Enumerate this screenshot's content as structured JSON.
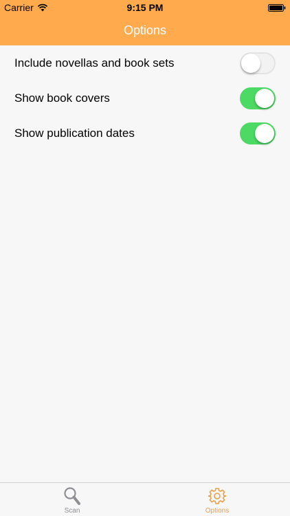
{
  "status": {
    "carrier": "Carrier",
    "time": "9:15 PM"
  },
  "header": {
    "title": "Options"
  },
  "options": [
    {
      "label": "Include novellas and book sets",
      "enabled": false
    },
    {
      "label": "Show book covers",
      "enabled": true
    },
    {
      "label": "Show publication dates",
      "enabled": true
    }
  ],
  "tabs": [
    {
      "label": "Scan",
      "icon": "search-icon"
    },
    {
      "label": "Options",
      "icon": "gear-icon"
    }
  ],
  "colors": {
    "header": "#ffaa4d",
    "toggle_on": "#4cd964",
    "tab_active": "#e8a04a",
    "tab_inactive": "#8e8e93"
  }
}
